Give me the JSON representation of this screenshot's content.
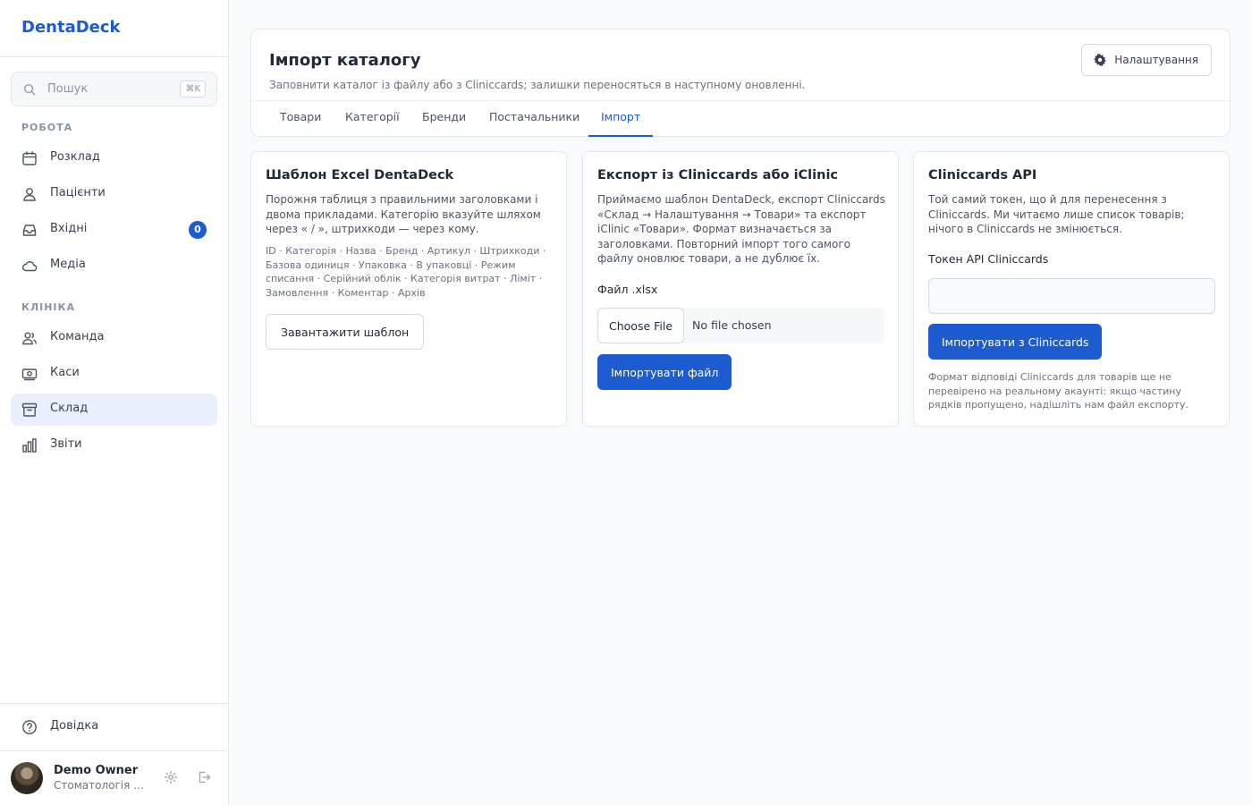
{
  "brand": "DentaDeck",
  "search": {
    "placeholder": "Пошук",
    "shortcut": "⌘K"
  },
  "sidebar": {
    "sections": [
      {
        "label": "РОБОТА",
        "items": [
          {
            "label": "Розклад",
            "icon": "calendar-icon"
          },
          {
            "label": "Пацієнти",
            "icon": "users-icon"
          },
          {
            "label": "Вхідні",
            "icon": "inbox-icon",
            "badge": "0"
          },
          {
            "label": "Медіа",
            "icon": "cloud-icon"
          }
        ]
      },
      {
        "label": "КЛІНІКА",
        "items": [
          {
            "label": "Команда",
            "icon": "team-icon"
          },
          {
            "label": "Каси",
            "icon": "cash-icon"
          },
          {
            "label": "Склад",
            "icon": "archive-icon",
            "active": true
          },
          {
            "label": "Звіти",
            "icon": "bar-chart-icon"
          }
        ]
      }
    ],
    "help": {
      "label": "Довідка",
      "icon": "help-icon"
    }
  },
  "user": {
    "name": "Demo Owner",
    "clinic": "Стоматологія П..."
  },
  "page": {
    "title": "Імпорт каталогу",
    "subtitle": "Заповнити каталог із файлу або з Cliniccards; залишки переносяться в наступному оновленні.",
    "settings_label": "Налаштування",
    "tabs": [
      {
        "label": "Товари"
      },
      {
        "label": "Категорії"
      },
      {
        "label": "Бренди"
      },
      {
        "label": "Постачальники"
      },
      {
        "label": "Імпорт",
        "active": true
      }
    ]
  },
  "cards": {
    "template": {
      "title": "Шаблон Excel DentaDeck",
      "desc": "Порожня таблиця з правильними заголовками і двома прикладами. Категорію вказуйте шляхом через « / », штрихкоди — через кому.",
      "columns": "ID · Категорія · Назва · Бренд · Артикул · Штрихкоди · Базова одиниця · Упаковка · В упаковці · Режим списання · Серійний облік · Категорія витрат · Ліміт · Замовлення · Коментар · Архів",
      "button": "Завантажити шаблон"
    },
    "export": {
      "title": "Експорт із Cliniccards або iClinic",
      "desc": "Приймаємо шаблон DentaDeck, експорт Cliniccards «Склад → Налаштування → Товари» та експорт iClinic «Товари». Формат визначається за заголовками. Повторний імпорт того самого файлу оновлює товари, а не дублює їх.",
      "file_label": "Файл .xlsx",
      "choose_label": "Choose File",
      "file_status": "No file chosen",
      "button": "Імпортувати файл"
    },
    "api": {
      "title": "Cliniccards API",
      "desc": "Той самий токен, що й для перенесення з Cliniccards. Ми читаємо лише список товарів; нічого в Cliniccards не змінюється.",
      "token_label": "Токен API Cliniccards",
      "token_value": "",
      "button": "Імпортувати з Cliniccards",
      "note": "Формат відповіді Cliniccards для товарів ще не перевірено на реальному акаунті: якщо частину рядків пропущено, надішліть нам файл експорту."
    }
  },
  "colors": {
    "accent": "#1d5bd1",
    "active_bg": "#e8f0fe"
  }
}
